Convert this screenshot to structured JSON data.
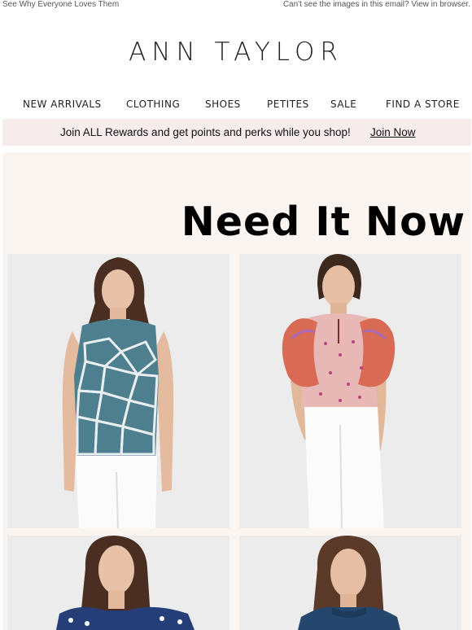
{
  "preheader": {
    "left_text": "See Why Everyone Loves Them",
    "right_text": "Can't see the images in this email? View in browser."
  },
  "brand": {
    "logo_text": "ANN TAYLOR"
  },
  "nav": {
    "items": [
      {
        "label": "NEW ARRIVALS"
      },
      {
        "label": "CLOTHING"
      },
      {
        "label": "SHOES"
      },
      {
        "label": "PETITES"
      },
      {
        "label": "SALE"
      },
      {
        "label": "FIND A STORE"
      }
    ]
  },
  "rewards": {
    "message": "Join ALL Rewards and get points and perks while you shop!",
    "link_label": "Join Now"
  },
  "hero": {
    "headline": "Need It Now"
  },
  "colors": {
    "rewards_bg": "#f7ecec",
    "panel_bg": "#faf5f0",
    "photo_bg": "#ececec"
  },
  "products": [
    {
      "icon": "giraffe-print-shell-top-image"
    },
    {
      "icon": "floral-ruffle-top-image"
    },
    {
      "icon": "navy-print-ruffle-top-image"
    },
    {
      "icon": "navy-ruffle-neck-top-image"
    }
  ]
}
